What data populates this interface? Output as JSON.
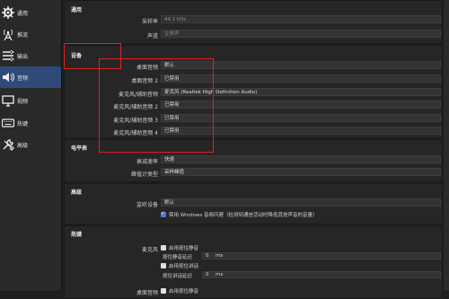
{
  "sidebar": {
    "items": [
      {
        "label": "通用",
        "icon": "gear-icon"
      },
      {
        "label": "推流",
        "icon": "broadcast-icon"
      },
      {
        "label": "输出",
        "icon": "output-icon"
      },
      {
        "label": "音频",
        "icon": "speaker-icon",
        "active": true
      },
      {
        "label": "视频",
        "icon": "monitor-icon"
      },
      {
        "label": "热键",
        "icon": "keyboard-icon"
      },
      {
        "label": "高级",
        "icon": "tools-icon"
      }
    ]
  },
  "general": {
    "title": "通用",
    "sample_rate_label": "采样率",
    "sample_rate_value": "44.1 kHz",
    "channels_label": "声道",
    "channels_value": "立体声"
  },
  "devices": {
    "title": "设备",
    "rows": [
      {
        "label": "桌面音频",
        "value": "默认"
      },
      {
        "label": "桌面音频 2",
        "value": "已禁用"
      },
      {
        "label": "麦克风/辅助音频",
        "value": "麦克风 (Realtek High Definition Audio)"
      },
      {
        "label": "麦克风/辅助音频 2",
        "value": "已禁用"
      },
      {
        "label": "麦克风/辅助音频 3",
        "value": "已禁用"
      },
      {
        "label": "麦克风/辅助音频 4",
        "value": "已禁用"
      }
    ]
  },
  "meters": {
    "title": "电平表",
    "decay_label": "衰减速率",
    "decay_value": "快速",
    "peak_label": "峰值计类型",
    "peak_value": "采样峰值"
  },
  "advanced": {
    "title": "高级",
    "monitor_label": "监听设备",
    "monitor_value": "默认",
    "ducking_label": "禁用 Windows 音频闪避（检测到通信活动时降低其他声音的音量）",
    "ducking_checked": true
  },
  "hotkeys": {
    "title": "热键",
    "source_label": "麦克风",
    "ptm_enable_label": "启用按住静音",
    "ptm_delay_label": "按住静音延迟",
    "ptm_delay_value": "0",
    "ptm_delay_unit": "ms",
    "ptt_enable_label": "启用按住讲话",
    "ptt_delay_label": "按住讲话延迟",
    "ptt_delay_value": "0",
    "ptt_delay_unit": "ms",
    "desktop_label": "桌面音频",
    "desktop_ptm_label": "启用按住静音"
  },
  "colors": {
    "annotation": "#e0211f",
    "active_nav": "#2f4a78"
  }
}
